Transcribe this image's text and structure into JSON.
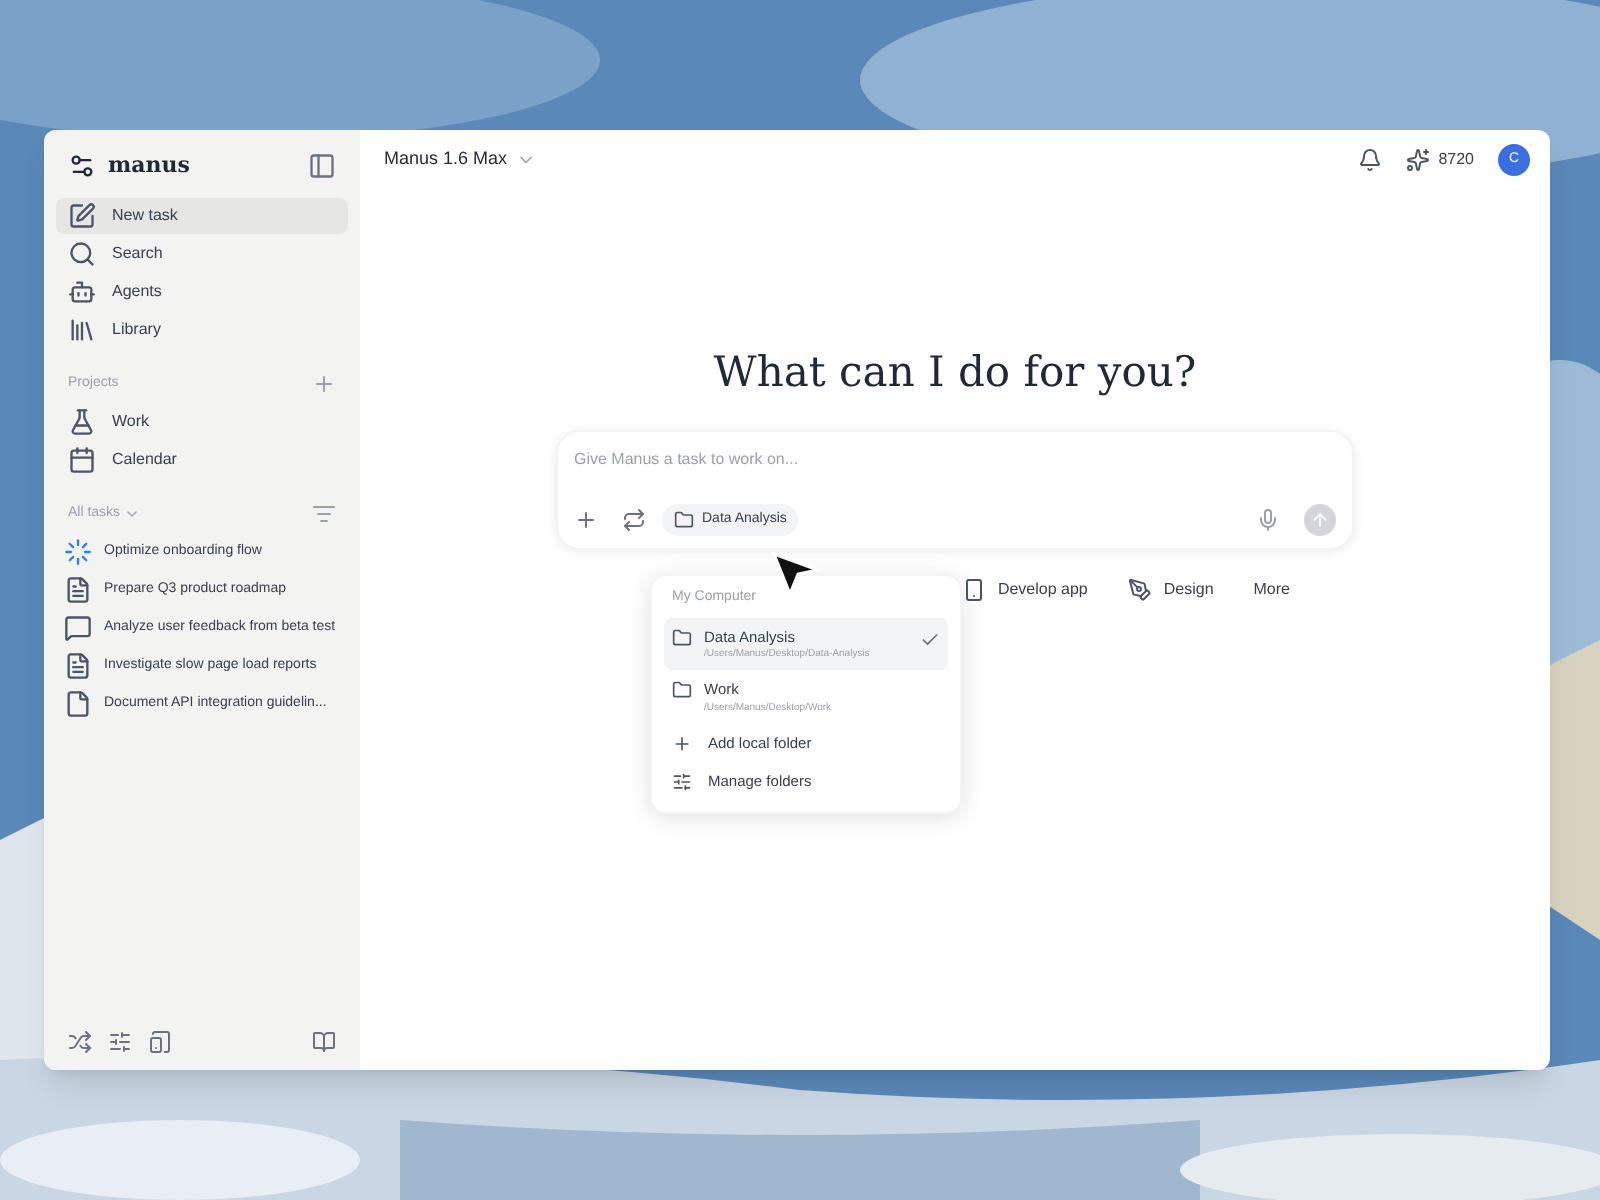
{
  "sidebar": {
    "brand": "manus",
    "nav": [
      {
        "label": "New task",
        "kind": "edit",
        "selected": true
      },
      {
        "label": "Search",
        "kind": "search",
        "selected": false
      },
      {
        "label": "Agents",
        "kind": "agents",
        "selected": false
      },
      {
        "label": "Library",
        "kind": "library",
        "selected": false
      }
    ],
    "projects_label": "Projects",
    "projects": [
      {
        "label": "Work",
        "kind": "flask"
      },
      {
        "label": "Calendar",
        "kind": "calendar"
      }
    ],
    "tasks_label": "All tasks",
    "tasks": [
      {
        "label": "Optimize onboarding flow",
        "kind": "running"
      },
      {
        "label": "Prepare Q3 product roadmap",
        "kind": "doc"
      },
      {
        "label": "Analyze user feedback from beta test",
        "kind": "chat"
      },
      {
        "label": "Investigate slow page load reports",
        "kind": "doc"
      },
      {
        "label": "Document API integration guidelin...",
        "kind": "file"
      }
    ]
  },
  "header": {
    "model": "Manus 1.6 Max",
    "credits": "8720",
    "avatar": "C"
  },
  "main": {
    "heading": "What can I do for you?",
    "input": {
      "placeholder": "Give Manus a task to work on..."
    },
    "folder_chip": "Data Analysis",
    "chips": [
      {
        "label": "Develop app",
        "kind": "phone"
      },
      {
        "label": "Design",
        "kind": "pen"
      },
      {
        "label": "More",
        "kind": "none"
      }
    ]
  },
  "dropdown": {
    "section": "My Computer",
    "folders": [
      {
        "name": "Data Analysis",
        "path": "/Users/Manus/Desktop/Data-Analysis",
        "selected": true
      },
      {
        "name": "Work",
        "path": "/Users/Manus/Desktop/Work",
        "selected": false
      }
    ],
    "actions": [
      {
        "label": "Add local folder",
        "kind": "add"
      },
      {
        "label": "Manage folders",
        "kind": "manage"
      }
    ]
  }
}
